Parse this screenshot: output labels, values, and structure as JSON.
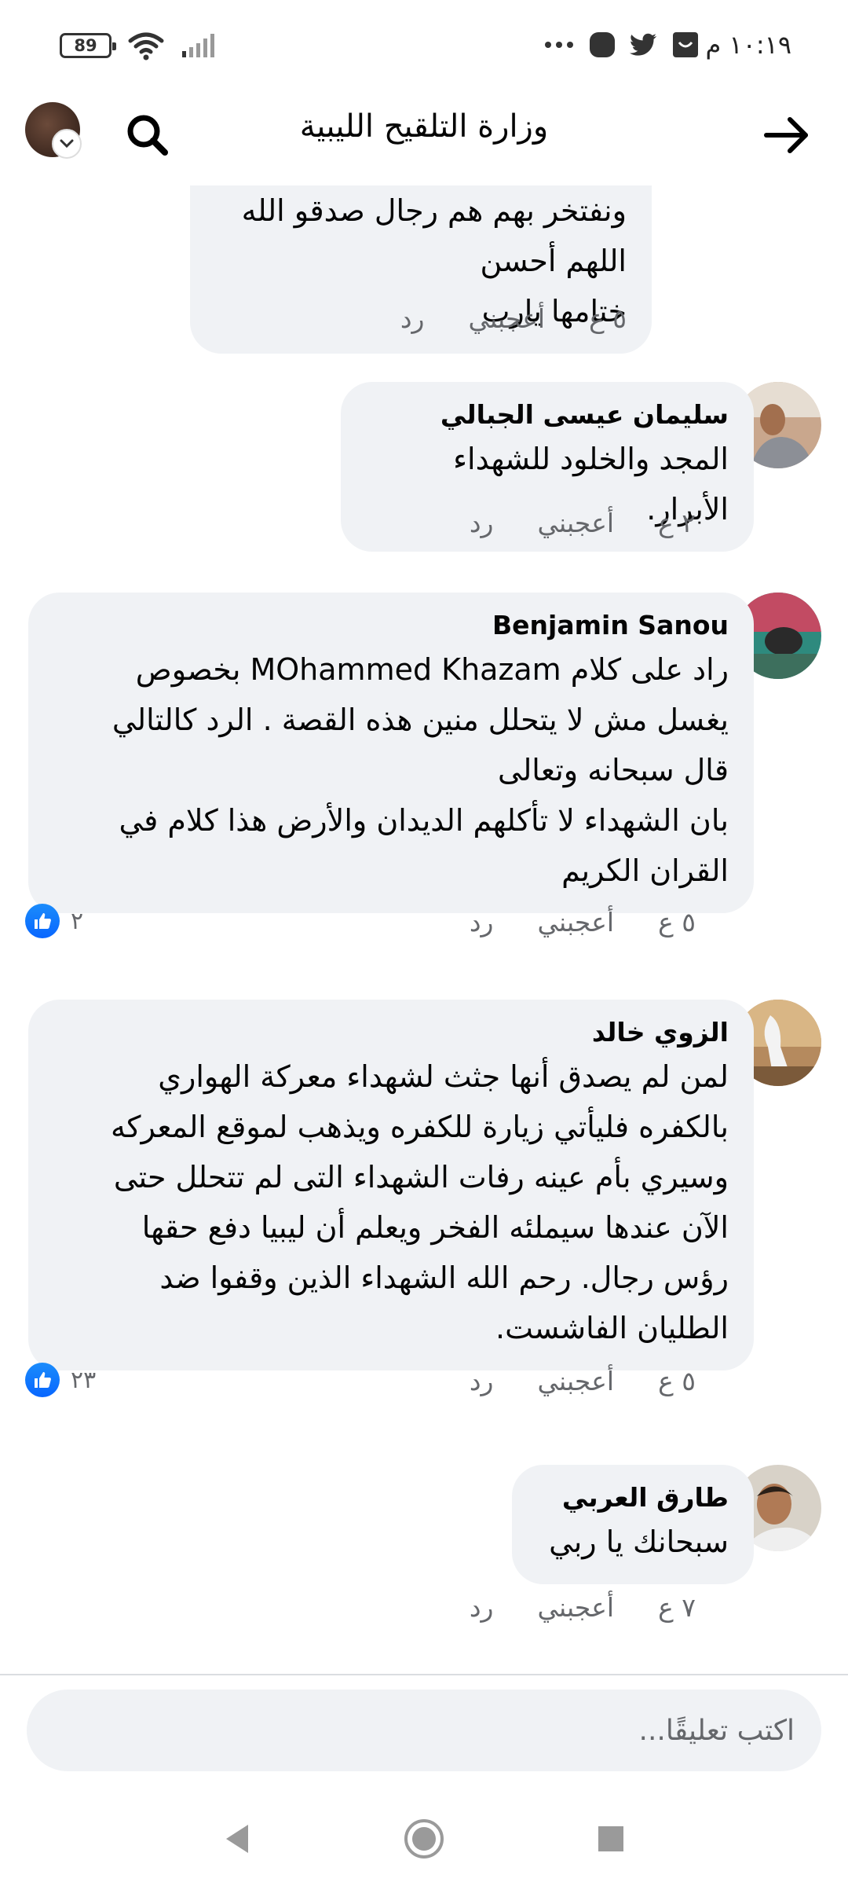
{
  "status_bar": {
    "time": "١٠:١٩ م",
    "battery": "89",
    "icons": [
      "circle-app-icon",
      "twitter-icon",
      "inbox-icon",
      "more-dots-icon",
      "wifi-icon",
      "signal-icon"
    ]
  },
  "header": {
    "title": "وزارة التلقيح الليبية",
    "back_icon": "arrow-right-icon",
    "search_icon": "search-icon"
  },
  "comments": [
    {
      "id": "c0",
      "name": "",
      "text": "ونفتخر بهم هم رجال صدقو الله اللهم أحسن\nختامها يارب",
      "time": "٥ ع",
      "like_label": "أعجبني",
      "reply_label": "رد",
      "reactions": ""
    },
    {
      "id": "c1",
      "name": "سليمان عيسى الجبالي",
      "text": "المجد والخلود للشهداء الأبرار.",
      "time": "٢ ع",
      "like_label": "أعجبني",
      "reply_label": "رد",
      "reactions": ""
    },
    {
      "id": "c2",
      "name": "Benjamin Sanou",
      "text": "راد على كلام MOhammed Khazam بخصوص\nيغسل مش لا يتحلل  منين هذه القصة . الرد كالتالي\nقال سبحانه وتعالى\nبان الشهداء لا تأكلهم الديدان والأرض هذا كلام في\nالقران الكريم",
      "time": "٥ ع",
      "like_label": "أعجبني",
      "reply_label": "رد",
      "reactions": "٢"
    },
    {
      "id": "c3",
      "name": "الزوي خالد",
      "text": "لمن لم يصدق أنها  جثث لشهداء معركة الهواري\nبالكفره فليأتي زيارة للكفره ويذهب لموقع المعركه\nوسيري بأم عينه رفات الشهداء التى لم تتحلل حتى\nالآن عندها سيملئه الفخر ويعلم أن ليبيا دفع حقها\nرؤس رجال. رحم الله الشهداء الذين وقفوا ضد\nالطليان  الفاشست.",
      "time": "٥ ع",
      "like_label": "أعجبني",
      "reply_label": "رد",
      "reactions": "٢٣"
    },
    {
      "id": "c4",
      "name": "طارق العربي",
      "text": "سبحانك يا ربي",
      "time": "٧ ع",
      "like_label": "أعجبني",
      "reply_label": "رد",
      "reactions": ""
    }
  ],
  "composer": {
    "placeholder": "اكتب تعليقًا..."
  },
  "nav": {
    "back": "back-triangle-icon",
    "home": "home-circle-icon",
    "recents": "recents-square-icon"
  },
  "colors": {
    "bubble": "#f0f2f5",
    "like_blue": "#0866ff",
    "meta_gray": "#65676b"
  }
}
